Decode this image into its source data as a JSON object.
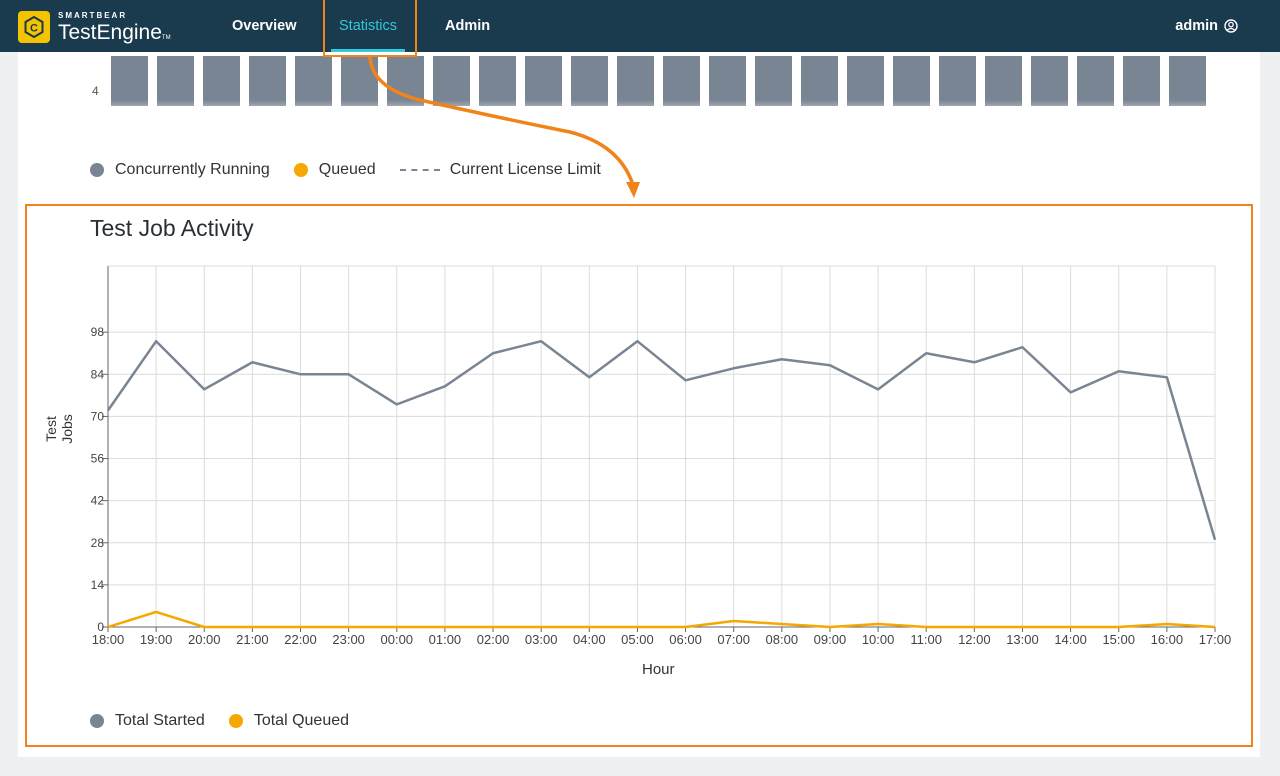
{
  "app": {
    "brand": "SMARTBEAR",
    "product": "TestEngine",
    "trademark": "TM"
  },
  "nav": {
    "items": [
      {
        "label": "Overview",
        "active": false
      },
      {
        "label": "Statistics",
        "active": true
      },
      {
        "label": "Admin",
        "active": false
      }
    ],
    "user": "admin"
  },
  "upper_chart": {
    "visible_tick": "4",
    "legend": [
      {
        "label": "Concurrently Running",
        "color": "#7a8593",
        "style": "dot"
      },
      {
        "label": "Queued",
        "color": "#f5a800",
        "style": "dot"
      },
      {
        "label": "Current License Limit",
        "color": "#7a8593",
        "style": "dashed"
      }
    ]
  },
  "activity": {
    "title": "Test Job Activity",
    "legend": [
      {
        "label": "Total Started",
        "color": "#7a8593"
      },
      {
        "label": "Total Queued",
        "color": "#f5a800"
      }
    ]
  },
  "chart_data": {
    "type": "line",
    "title": "Test Job Activity",
    "xlabel": "Hour",
    "ylabel": "Test Jobs",
    "x": [
      "18:00",
      "19:00",
      "20:00",
      "21:00",
      "22:00",
      "23:00",
      "00:00",
      "01:00",
      "02:00",
      "03:00",
      "04:00",
      "05:00",
      "06:00",
      "07:00",
      "08:00",
      "09:00",
      "10:00",
      "11:00",
      "12:00",
      "13:00",
      "14:00",
      "15:00",
      "16:00",
      "17:00"
    ],
    "yticks": [
      0,
      14,
      28,
      42,
      56,
      70,
      84,
      98
    ],
    "ylim": [
      0,
      120
    ],
    "grid": true,
    "legend_position": "bottom-left",
    "series": [
      {
        "name": "Total Started",
        "color": "#7a8593",
        "values": [
          72,
          95,
          79,
          88,
          84,
          84,
          74,
          80,
          91,
          95,
          83,
          95,
          82,
          86,
          89,
          87,
          79,
          91,
          88,
          93,
          78,
          85,
          83,
          29
        ]
      },
      {
        "name": "Total Queued",
        "color": "#f5a800",
        "values": [
          0,
          5,
          0,
          0,
          0,
          0,
          0,
          0,
          0,
          0,
          0,
          0,
          0,
          2,
          1,
          0,
          1,
          0,
          0,
          0,
          0,
          0,
          1,
          0
        ]
      }
    ]
  }
}
